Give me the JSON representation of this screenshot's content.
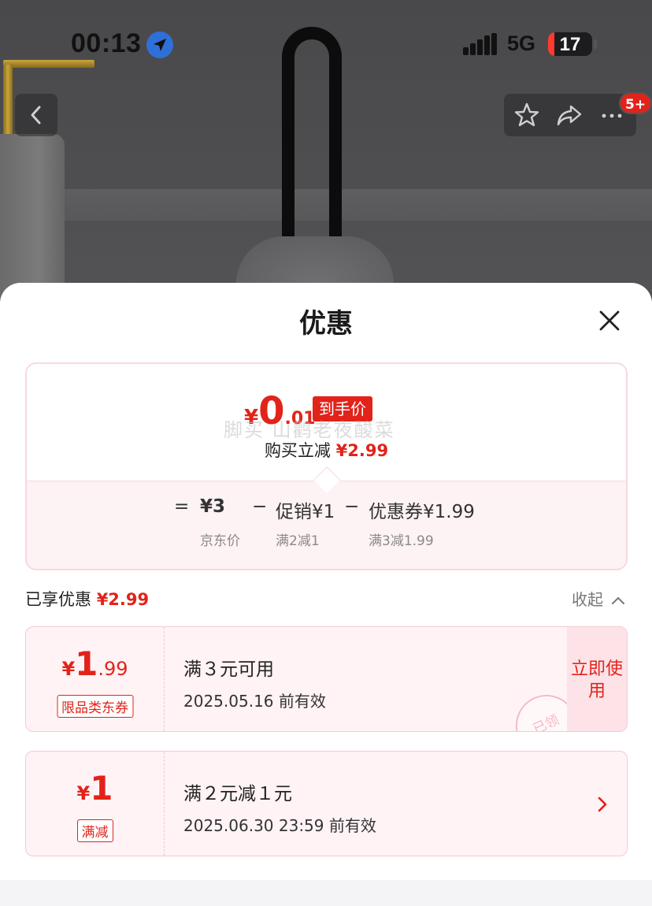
{
  "status_bar": {
    "time": "00:13",
    "network": "5G",
    "battery": "17"
  },
  "nav": {
    "badge": "5+"
  },
  "sheet": {
    "title": "优惠",
    "summary": {
      "price_yen": "¥",
      "price_int": "0",
      "price_dec": ".01",
      "final_tag": "到手价",
      "watermark": "脚买 山鹳老夜酸菜",
      "subline_text": "购买立减",
      "subline_amount": "¥2.99",
      "formula": {
        "eq": "=",
        "jd_price": "¥3",
        "minus1": "−",
        "promo": "促销¥1",
        "minus2": "−",
        "coupon": "优惠券¥1.99",
        "note_jd": "京东价",
        "note_promo": "满2减1",
        "note_coupon": "满3减1.99"
      }
    },
    "enjoyed": {
      "label": "已享优惠",
      "amount": "¥2.99",
      "collapse": "收起"
    },
    "coupons": [
      {
        "yen": "¥",
        "int": "1",
        "dec": ".99",
        "tag": "限品类东券",
        "condition": "满３元可用",
        "expiry": "2025.05.16 前有效",
        "action": "立即使用",
        "stamp": "已领"
      },
      {
        "yen": "¥",
        "int": "1",
        "dec": "",
        "tag": "满减",
        "condition": "满２元减１元",
        "expiry": "2025.06.30 23:59 前有效"
      }
    ]
  },
  "colors": {
    "accent": "#e2231a",
    "card_border": "#f7d9de",
    "coupon_bg": "#fff3f5"
  }
}
